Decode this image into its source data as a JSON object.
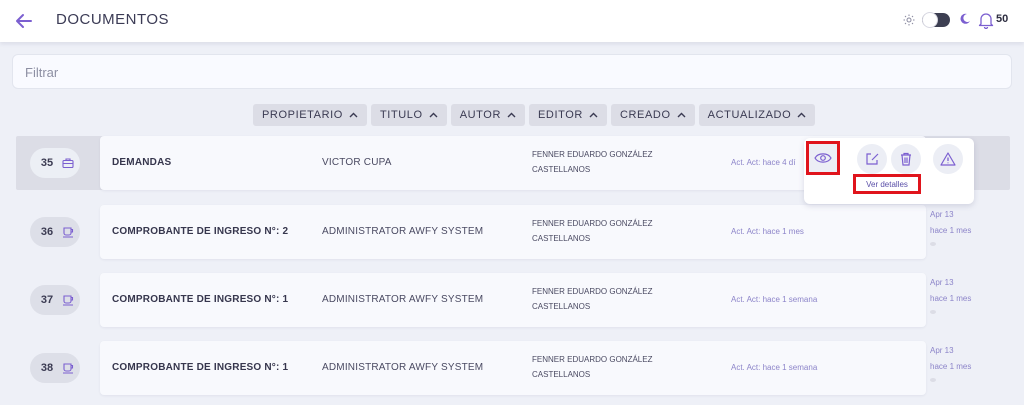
{
  "header": {
    "title": "DOCUMENTOS",
    "notification_count": "50"
  },
  "filter": {
    "placeholder": "Filtrar"
  },
  "sort_columns": [
    "PROPIETARIO",
    "TITULO",
    "AUTOR",
    "EDITOR",
    "CREADO",
    "ACTUALIZADO"
  ],
  "rows": [
    {
      "num": "35",
      "title": "DEMANDAS",
      "owner": "VICTOR CUPA",
      "editor_line1": "FENNER EDUARDO GONZÁLEZ",
      "editor_line2": "CASTELLANOS",
      "updated": "Act. Act: hace 4 dí",
      "side_date": "",
      "side_ago": "",
      "icon": "briefcase-icon"
    },
    {
      "num": "36",
      "title": "COMPROBANTE DE INGRESO N°: 2",
      "owner": "ADMINISTRATOR AWFY SYSTEM",
      "editor_line1": "FENNER EDUARDO GONZÁLEZ",
      "editor_line2": "CASTELLANOS",
      "updated": "Act. Act: hace 1 mes",
      "side_date": "Apr 13",
      "side_ago": "hace 1 mes",
      "icon": "cup-icon"
    },
    {
      "num": "37",
      "title": "COMPROBANTE DE INGRESO N°: 1",
      "owner": "ADMINISTRATOR AWFY SYSTEM",
      "editor_line1": "FENNER EDUARDO GONZÁLEZ",
      "editor_line2": "CASTELLANOS",
      "updated": "Act. Act: hace 1 semana",
      "side_date": "Apr 13",
      "side_ago": "hace 1 mes",
      "icon": "cup-icon"
    },
    {
      "num": "38",
      "title": "COMPROBANTE DE INGRESO N°: 1",
      "owner": "ADMINISTRATOR AWFY SYSTEM",
      "editor_line1": "FENNER EDUARDO GONZÁLEZ",
      "editor_line2": "CASTELLANOS",
      "updated": "Act. Act: hace 1 semana",
      "side_date": "Apr 13",
      "side_ago": "hace 1 mes",
      "icon": "cup-icon"
    }
  ],
  "actions": {
    "view_tooltip": "Ver detalles",
    "icons": [
      "eye-icon",
      "edit-icon",
      "trash-icon",
      "warning-icon"
    ]
  },
  "colors": {
    "accent": "#7b5fd0",
    "highlight_frame": "#e0141c",
    "background": "#eef0f7"
  }
}
